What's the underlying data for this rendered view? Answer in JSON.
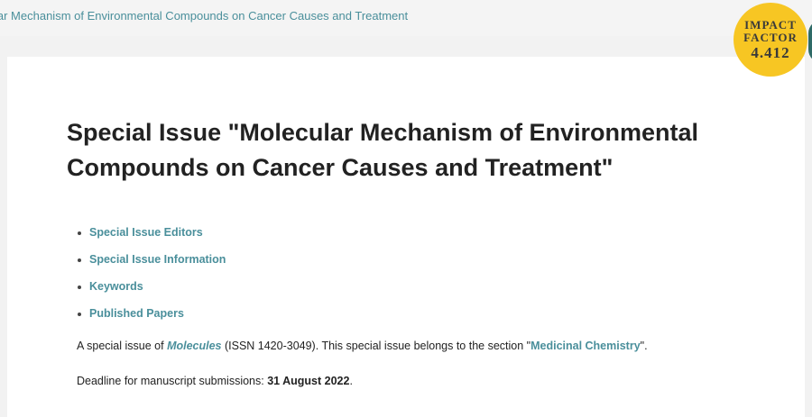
{
  "breadcrumb": {
    "text": "lar Mechanism of Environmental Compounds on Cancer Causes and Treatment"
  },
  "badge": {
    "line1": "IMPACT",
    "line2": "FACTOR",
    "value": "4.412"
  },
  "title": "Special Issue \"Molecular Mechanism of Environmental Compounds on Cancer Causes and Treatment\"",
  "toc": [
    {
      "label": "Special Issue Editors"
    },
    {
      "label": "Special Issue Information"
    },
    {
      "label": "Keywords"
    },
    {
      "label": "Published Papers"
    }
  ],
  "info": {
    "prefix": "A special issue of ",
    "journal": "Molecules",
    "issn": " (ISSN 1420-3049). This special issue belongs to the section \"",
    "section": "Medicinal Chemistry",
    "suffix": "\"."
  },
  "deadline": {
    "label": "Deadline for manuscript submissions: ",
    "date": "31 August 2022",
    "suffix": "."
  },
  "colors": {
    "link": "#4a8f9b",
    "badge": "#f7c623",
    "side": "#2f6b67"
  }
}
